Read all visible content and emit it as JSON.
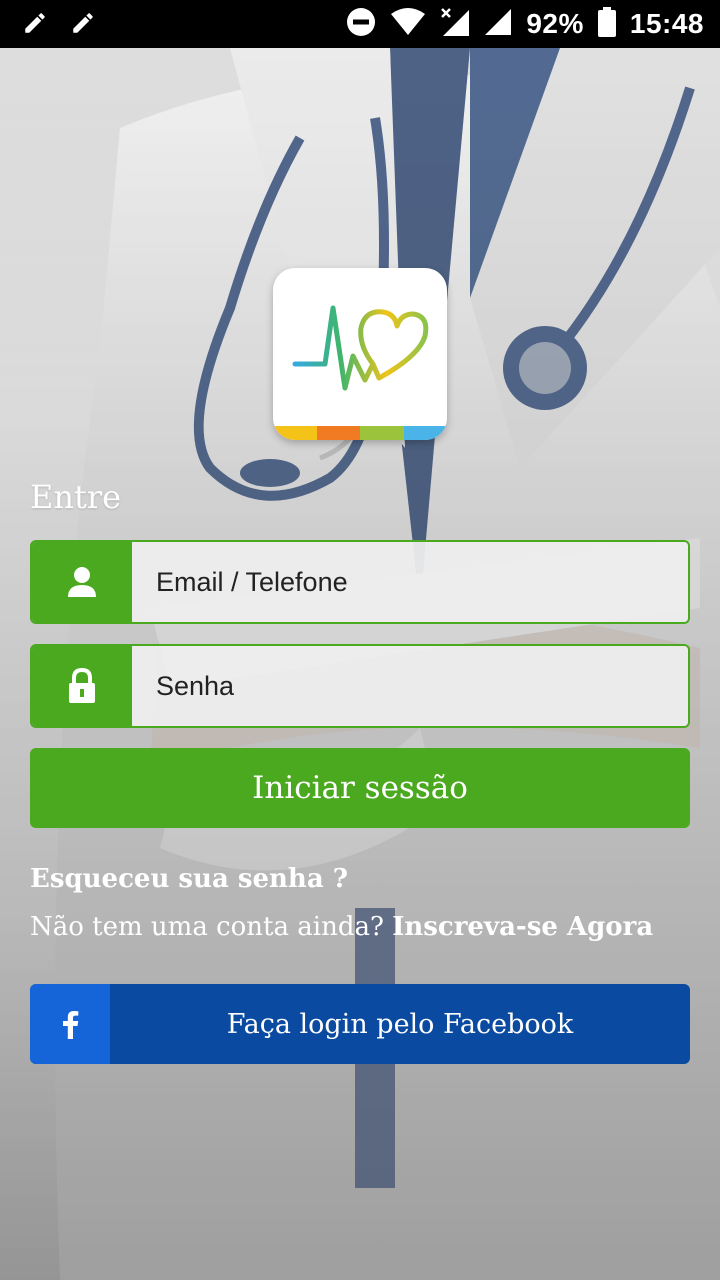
{
  "status_bar": {
    "battery_percent": "92%",
    "time": "15:48",
    "icons": [
      "edit-icon",
      "edit-icon",
      "do-not-disturb-icon",
      "wifi-icon",
      "signal-no-data-icon",
      "signal-icon",
      "battery-icon"
    ]
  },
  "app": {
    "logo_strip_colors": [
      "#f5c218",
      "#f07b22",
      "#9bc33c",
      "#4ab3e8"
    ],
    "accent_color": "#4aa91e",
    "facebook_color": "#0a4aa0"
  },
  "login": {
    "heading": "Entre",
    "email_placeholder": "Email / Telefone",
    "password_placeholder": "Senha",
    "submit_label": "Iniciar sessão",
    "forgot_password": "Esqueceu sua senha ?",
    "no_account_text": "Não tem uma conta ainda?",
    "signup_link": "Inscreva-se Agora",
    "facebook_label": "Faça login pelo Facebook"
  }
}
